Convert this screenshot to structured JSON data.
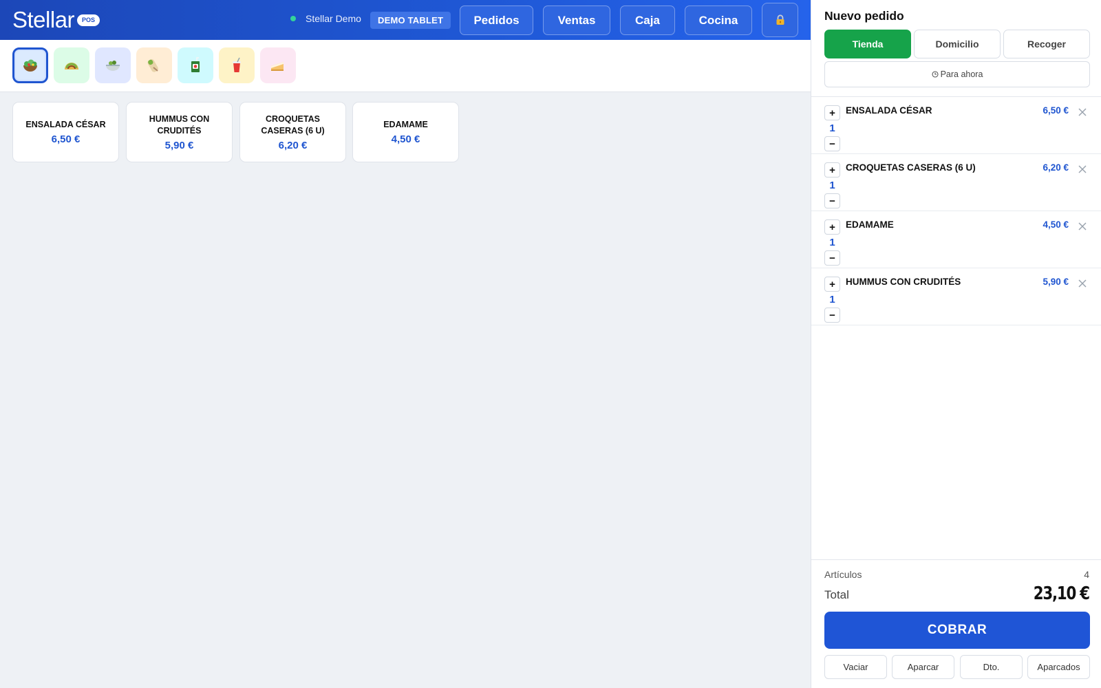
{
  "header": {
    "logo_text": "Stellar",
    "logo_badge": "POS",
    "store_name": "Stellar Demo",
    "device_badge": "DEMO TABLET",
    "status_color": "#34d399",
    "nav": [
      {
        "label": "Pedidos"
      },
      {
        "label": "Ventas"
      },
      {
        "label": "Caja"
      },
      {
        "label": "Cocina"
      }
    ],
    "lock_icon": "lock-icon"
  },
  "categories": [
    {
      "icon": "salad-icon",
      "bg": "#dbeafe",
      "active": true
    },
    {
      "icon": "taco-icon",
      "bg": "#dcfce7",
      "active": false
    },
    {
      "icon": "bowl-icon",
      "bg": "#e0e7ff",
      "active": false
    },
    {
      "icon": "wrap-icon",
      "bg": "#ffedd5",
      "active": false
    },
    {
      "icon": "juice-box-icon",
      "bg": "#cffafe",
      "active": false
    },
    {
      "icon": "drink-cup-icon",
      "bg": "#fef3c7",
      "active": false
    },
    {
      "icon": "cake-icon",
      "bg": "#fce7f3",
      "active": false
    }
  ],
  "products": [
    {
      "name": "ENSALADA CÉSAR",
      "price": "6,50 €"
    },
    {
      "name": "HUMMUS CON CRUDITÉS",
      "price": "5,90 €"
    },
    {
      "name": "CROQUETAS CASERAS (6 U)",
      "price": "6,20 €"
    },
    {
      "name": "EDAMAME",
      "price": "4,50 €"
    }
  ],
  "order": {
    "title": "Nuevo pedido",
    "modes": [
      {
        "label": "Tienda",
        "active": true
      },
      {
        "label": "Domicilio",
        "active": false
      },
      {
        "label": "Recoger",
        "active": false
      }
    ],
    "when_label": "Para ahora",
    "qty_plus": "+",
    "qty_minus": "−",
    "lines": [
      {
        "name": "ENSALADA CÉSAR",
        "qty": "1",
        "price": "6,50 €"
      },
      {
        "name": "CROQUETAS CASERAS (6 U)",
        "qty": "1",
        "price": "6,20 €"
      },
      {
        "name": "EDAMAME",
        "qty": "1",
        "price": "4,50 €"
      },
      {
        "name": "HUMMUS CON CRUDITÉS",
        "qty": "1",
        "price": "5,90 €"
      }
    ],
    "articles_label": "Artículos",
    "articles_count": "4",
    "total_label": "Total",
    "total_value": "23,10 €",
    "charge_label": "COBRAR",
    "actions": [
      {
        "label": "Vaciar"
      },
      {
        "label": "Aparcar"
      },
      {
        "label": "Dto."
      },
      {
        "label": "Aparcados"
      }
    ]
  },
  "colors": {
    "brand_blue": "#1f55d6",
    "accent_green": "#16a34a",
    "price_blue": "#1f55d0"
  }
}
